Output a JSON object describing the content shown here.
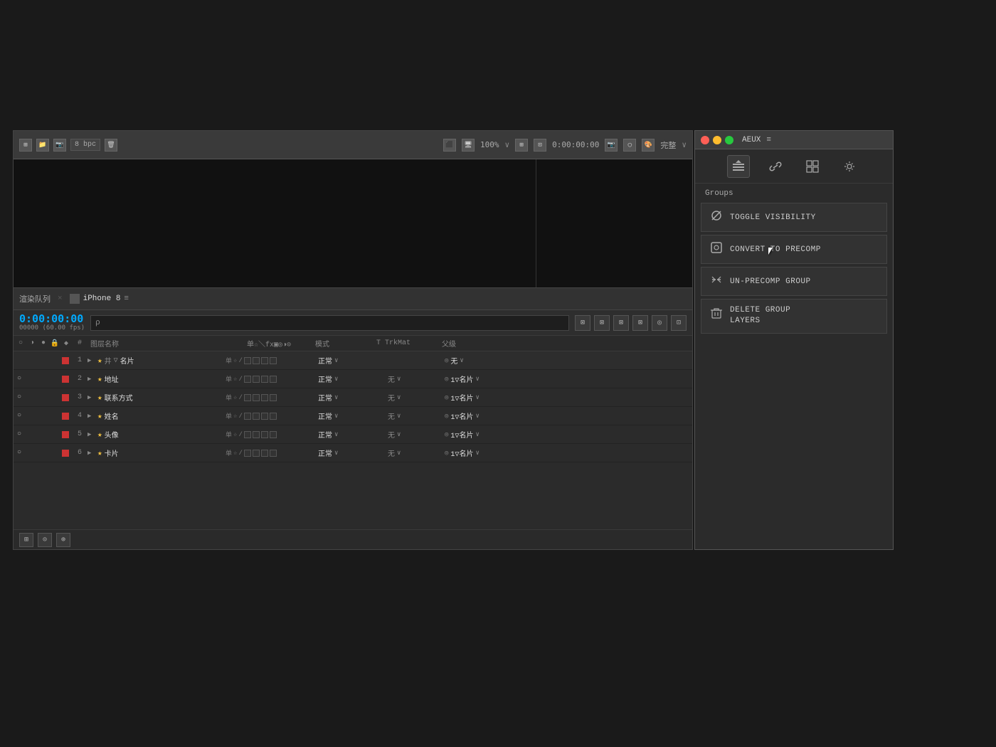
{
  "desktop": {
    "bg": "#1a1a1a"
  },
  "ae_panel": {
    "bpc": "8 bpc",
    "zoom": "100%",
    "timecode": "0:00:00:00",
    "quality": "完整",
    "tab_render_queue": "渲染队列",
    "tab_separator": "×",
    "tab_comp_name": "iPhone 8",
    "tab_menu": "≡",
    "current_time": "0:00:00:00",
    "fps_label": "00000 (60.00 fps)",
    "search_placeholder": "ρ",
    "col_headers": {
      "visibility": "○◑●",
      "num": "#",
      "name": "图层名称",
      "switches": "单☆＼fx▣◎◑⊙",
      "mode": "模式",
      "t": "T",
      "trkmat": "TrkMat",
      "parent": "父级"
    },
    "layers": [
      {
        "num": "1",
        "has_expand": true,
        "star": "★",
        "hash": "井",
        "triangle": "▽",
        "name": "名片",
        "switches": "单☆/",
        "mode": "正常",
        "t": "",
        "trkmat": "",
        "parent_icon": "◎",
        "parent": "无",
        "visible": false
      },
      {
        "num": "2",
        "has_expand": true,
        "star": "★",
        "name": "地址",
        "switches": "单☆/",
        "mode": "正常",
        "t": "",
        "trkmat": "无",
        "parent_icon": "◎",
        "parent": "1▽名片",
        "visible": true
      },
      {
        "num": "3",
        "has_expand": true,
        "star": "★",
        "name": "联系方式",
        "switches": "单☆/",
        "mode": "正常",
        "t": "",
        "trkmat": "无",
        "parent_icon": "◎",
        "parent": "1▽名片",
        "visible": true
      },
      {
        "num": "4",
        "has_expand": true,
        "star": "★",
        "name": "姓名",
        "switches": "单☆/",
        "mode": "正常",
        "t": "",
        "trkmat": "无",
        "parent_icon": "◎",
        "parent": "1▽名片",
        "visible": true
      },
      {
        "num": "5",
        "has_expand": true,
        "star": "★",
        "name": "头像",
        "switches": "单☆/",
        "mode": "正常",
        "t": "",
        "trkmat": "无",
        "parent_icon": "◎",
        "parent": "1▽名片",
        "visible": true
      },
      {
        "num": "6",
        "has_expand": true,
        "star": "★",
        "name": "卡片",
        "switches": "单☆/",
        "mode": "正常",
        "t": "",
        "trkmat": "无",
        "parent_icon": "◎",
        "parent": "1▽名片",
        "visible": true
      }
    ],
    "bottom_btns": [
      "⊞",
      "⊙",
      "⊕"
    ]
  },
  "aeux_panel": {
    "title": "AEUX",
    "menu_icon": "≡",
    "tools": [
      {
        "icon": "◈",
        "name": "layers-icon",
        "active": true
      },
      {
        "icon": "🔗",
        "name": "link-icon",
        "active": false
      },
      {
        "icon": "▦",
        "name": "grid-icon",
        "active": false
      },
      {
        "icon": "⚙",
        "name": "settings-icon",
        "active": false
      }
    ],
    "groups_label": "Groups",
    "buttons": [
      {
        "icon": "⊘",
        "label": "TOGGLE VISIBILITY",
        "name": "toggle-visibility-button"
      },
      {
        "icon": "⊡",
        "label": "CONVERT TO PRECOMP",
        "name": "convert-precomp-button"
      },
      {
        "icon": "⤢",
        "label": "UN-PRECOMP GROUP",
        "name": "un-precomp-button"
      }
    ],
    "delete_btn": {
      "icon": "🗑",
      "line1": "DELETE GROUP",
      "line2": "LAYERS",
      "name": "delete-group-button"
    }
  }
}
